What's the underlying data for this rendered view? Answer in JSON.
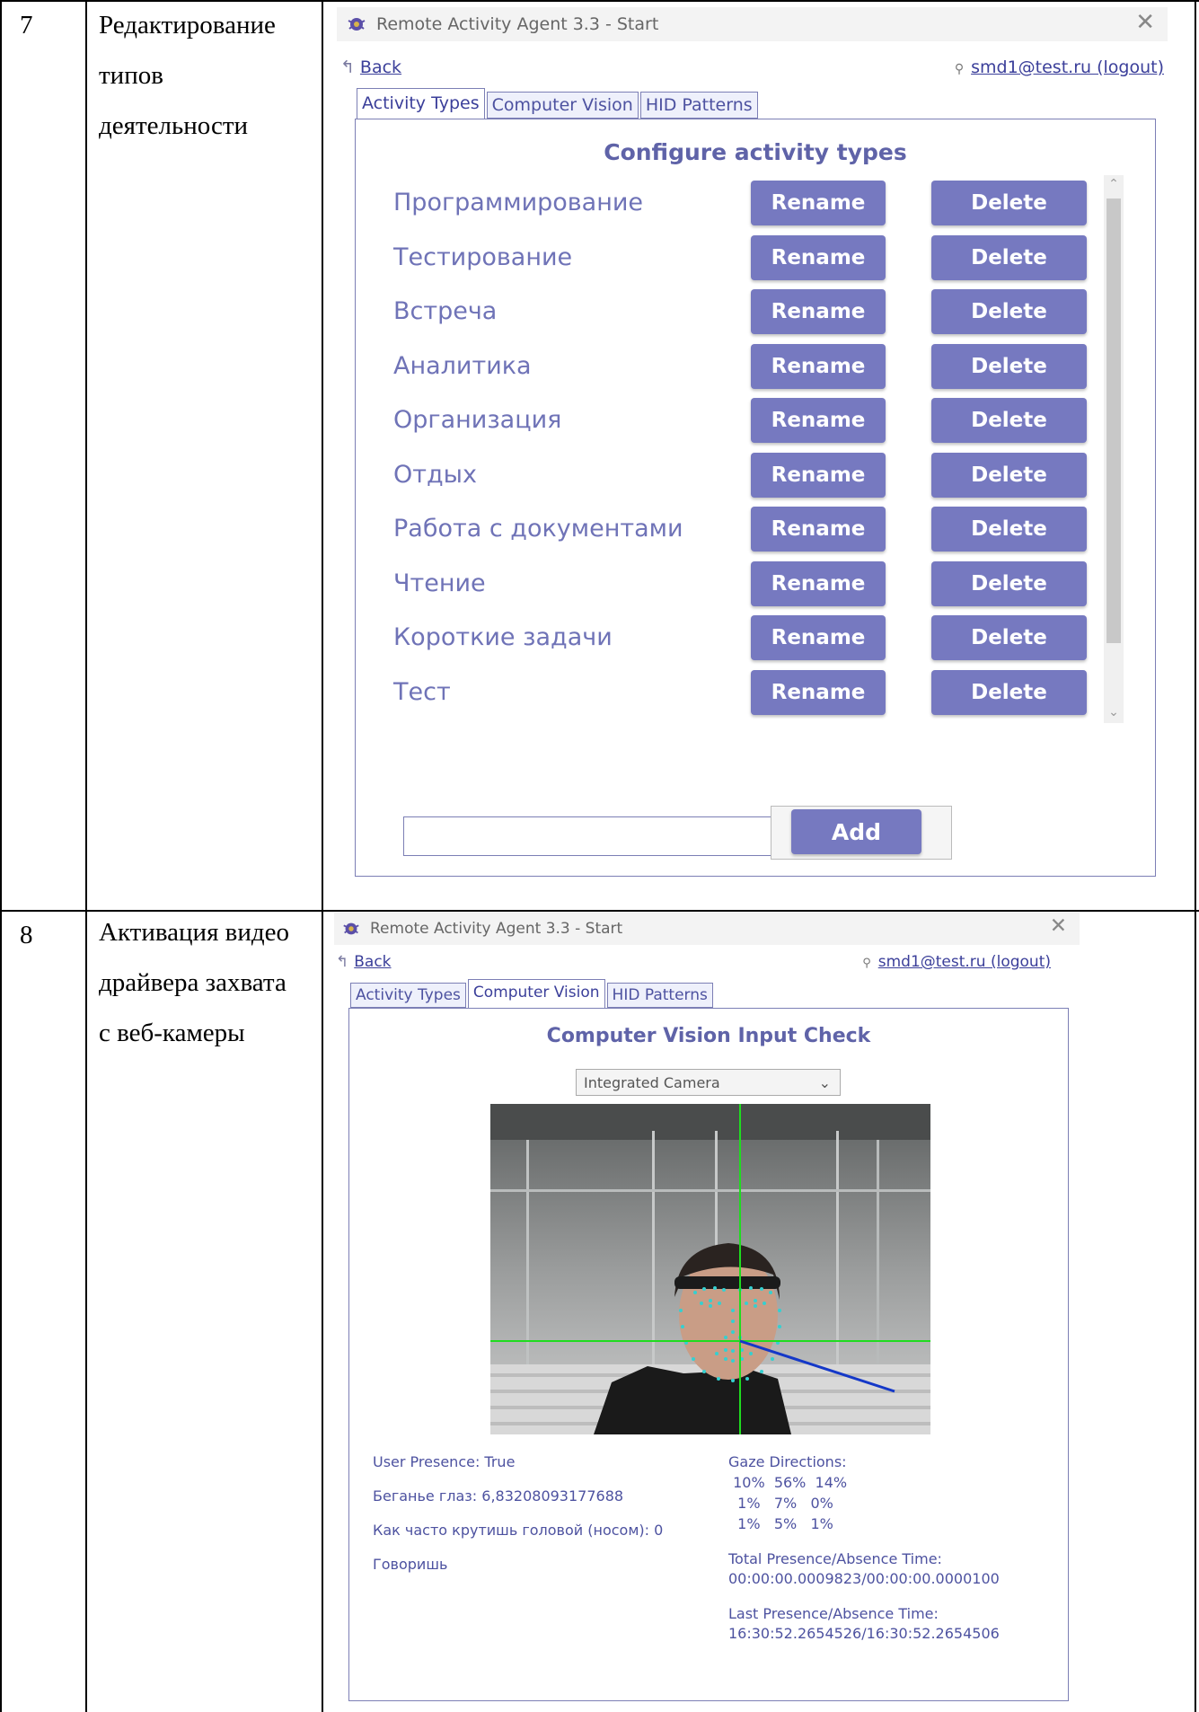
{
  "rows": [
    {
      "number": "7",
      "description": [
        "Редактирование",
        "типов",
        "деятельности"
      ],
      "window": {
        "title": "Remote Activity Agent 3.3 - Start",
        "back": "Back",
        "user": "smd1@test.ru (logout)",
        "tabs": [
          "Activity Types",
          "Computer Vision",
          "HID Patterns"
        ],
        "active_tab": 0,
        "heading": "Configure activity types",
        "activities": [
          "Программирование",
          "Тестирование",
          "Встреча",
          "Аналитика",
          "Организация",
          "Отдых",
          "Работа с документами",
          "Чтение",
          "Короткие задачи",
          "Тест"
        ],
        "rename_label": "Rename",
        "delete_label": "Delete",
        "new_activity_value": "",
        "add_label": "Add"
      }
    },
    {
      "number": "8",
      "description": [
        "Активация видео",
        "драйвера захвата",
        "с веб-камеры"
      ],
      "window": {
        "title": "Remote Activity Agent 3.3 - Start",
        "back": "Back",
        "user": "smd1@test.ru (logout)",
        "tabs": [
          "Activity Types",
          "Computer Vision",
          "HID Patterns"
        ],
        "active_tab": 1,
        "heading": "Computer Vision Input Check",
        "camera_selected": "Integrated Camera",
        "left_stats": [
          "User Presence: True",
          "Беганье глаз: 6,83208093177688",
          "Как часто крутишь головой (носом): 0",
          "Говоришь"
        ],
        "gaze_title": "Gaze Directions:",
        "gaze_rows": [
          " 10%  56%  14%",
          "  1%   7%   0%",
          "  1%   5%   1%"
        ],
        "total_label": "Total Presence/Absence Time:",
        "total_value": "00:00:00.0009823/00:00:00.0000100",
        "last_label": "Last Presence/Absence Time:",
        "last_value": "16:30:52.2654526/16:30:52.2654506"
      }
    }
  ],
  "colors": {
    "accent": "#7679c0",
    "text_accent": "#5f63a8",
    "border": "#7c7fb5"
  }
}
